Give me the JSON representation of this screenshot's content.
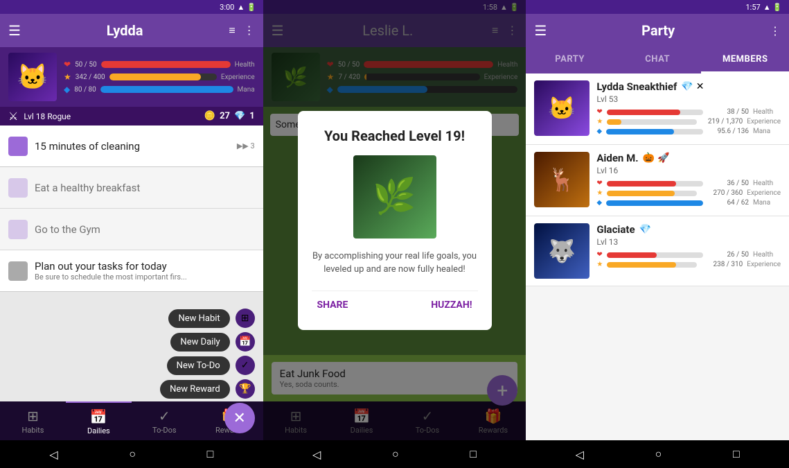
{
  "panel1": {
    "statusBar": {
      "time": "3:00",
      "icons": "▲ ▲ 🔋"
    },
    "header": {
      "menuIcon": "☰",
      "title": "Lydda",
      "filterIcon": "≡",
      "moreIcon": "⋮"
    },
    "character": {
      "avatar": "🐱",
      "healthLabel": "Health",
      "healthValue": "50 / 50",
      "healthPct": 100,
      "expLabel": "Experience",
      "expValue": "342 / 400",
      "expPct": 85,
      "manaLabel": "Mana",
      "manaValue": "80 / 80",
      "manaPct": 100,
      "level": "Lvl 18 Rogue",
      "coins": "27",
      "gems": "1"
    },
    "tasks": [
      {
        "title": "15 minutes of cleaning",
        "subtitle": "",
        "streak": "▶▶ 3"
      },
      {
        "title": "Eat a healthy breakfast",
        "subtitle": "",
        "streak": ""
      },
      {
        "title": "Go to the Gym",
        "subtitle": "",
        "streak": ""
      },
      {
        "title": "Plan out your tasks for today",
        "subtitle": "Be sure to schedule the most important firs...",
        "streak": ""
      }
    ],
    "fabMenu": [
      {
        "label": "New Habit",
        "icon": "⊞"
      },
      {
        "label": "New Daily",
        "icon": "📅"
      },
      {
        "label": "New To-Do",
        "icon": "✓"
      },
      {
        "label": "New Reward",
        "icon": "🏆"
      }
    ],
    "bottomNav": [
      {
        "icon": "⊞",
        "label": "Habits",
        "active": false
      },
      {
        "icon": "📅",
        "label": "Dailies",
        "active": true
      },
      {
        "icon": "✓",
        "label": "To-Dos",
        "active": false
      },
      {
        "icon": "🎁",
        "label": "Rewards",
        "active": false
      }
    ]
  },
  "panel2": {
    "statusBar": {
      "time": "1:58"
    },
    "header": {
      "menuIcon": "☰",
      "title": "Leslie L.",
      "filterIcon": "≡",
      "moreIcon": "⋮"
    },
    "character": {
      "avatar": "🌿",
      "healthValue": "50 / 50",
      "healthPct": 100,
      "expValue": "7 / 420",
      "expPct": 2,
      "level": ""
    },
    "modal": {
      "title": "You Reached Level 19!",
      "image": "🌿",
      "text": "By accomplishing your real life goals, you leveled up and are now fully healed!",
      "shareBtn": "SHARE",
      "huzzahBtn": "HUZZAH!"
    },
    "junkFood": {
      "title": "Eat Junk Food",
      "subtitle": "Yes, soda counts."
    },
    "bottomNav": [
      {
        "icon": "⊞",
        "label": "Habits"
      },
      {
        "icon": "📅",
        "label": "Dailies"
      },
      {
        "icon": "✓",
        "label": "To-Dos"
      },
      {
        "icon": "🎁",
        "label": "Rewards"
      }
    ]
  },
  "panel3": {
    "statusBar": {
      "time": "1:57"
    },
    "header": {
      "menuIcon": "☰",
      "title": "Party",
      "moreIcon": "⋮"
    },
    "tabs": [
      {
        "label": "PARTY",
        "active": false
      },
      {
        "label": "CHAT",
        "active": false
      },
      {
        "label": "MEMBERS",
        "active": true
      }
    ],
    "members": [
      {
        "name": "Lydda Sneakthief",
        "level": "Lvl 53",
        "icons": "💎 ✕",
        "avatar": "🐱",
        "healthValue": "38 / 50",
        "healthPct": 76,
        "healthLabel": "Health",
        "expValue": "219 / 1,370",
        "expPct": 16,
        "expLabel": "Experience",
        "manaValue": "95.6 / 136",
        "manaPct": 70,
        "manaLabel": "Mana"
      },
      {
        "name": "Aiden M.",
        "level": "Lvl 16",
        "icons": "🎃 🚀",
        "avatar": "🦌",
        "healthValue": "36 / 50",
        "healthPct": 72,
        "healthLabel": "Health",
        "expValue": "270 / 360",
        "expPct": 75,
        "expLabel": "Experience",
        "manaValue": "64 / 62",
        "manaPct": 100,
        "manaLabel": "Mana"
      },
      {
        "name": "Glaciate",
        "level": "Lvl 13",
        "icons": "💎",
        "avatar": "🐺",
        "healthValue": "26 / 50",
        "healthPct": 52,
        "healthLabel": "Health",
        "expValue": "238 / 310",
        "expPct": 77,
        "expLabel": "Experience",
        "manaValue": "",
        "manaPct": 0,
        "manaLabel": ""
      }
    ]
  }
}
